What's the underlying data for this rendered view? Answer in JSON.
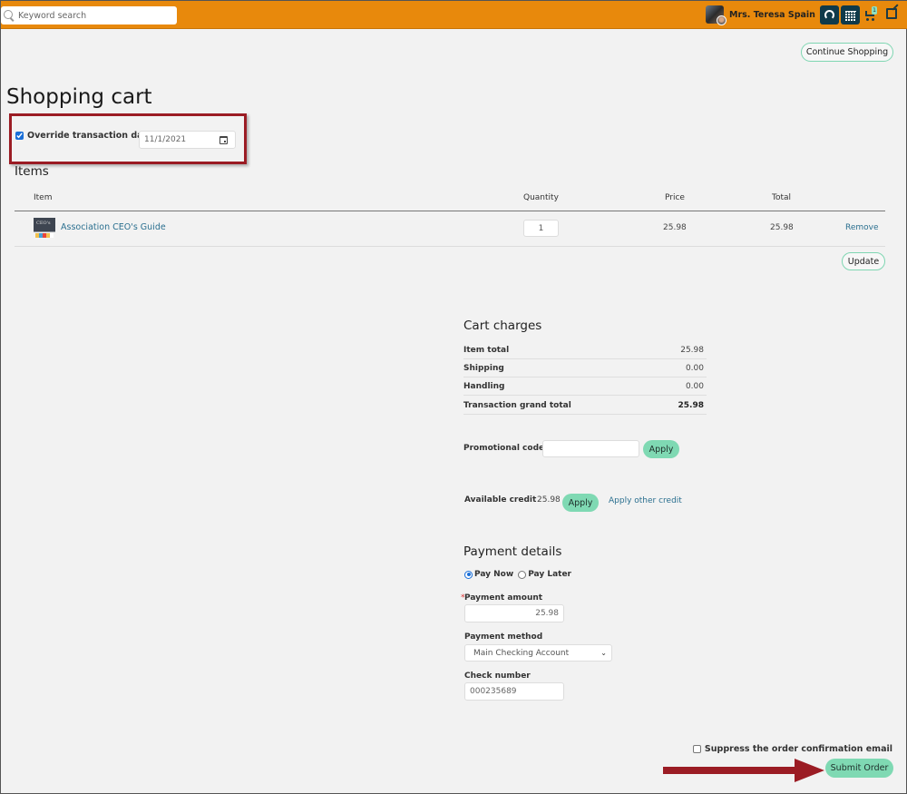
{
  "header": {
    "search_placeholder": "Keyword search",
    "user_name": "Mrs. Teresa Spain",
    "user_menu_chevron": "⌄",
    "cart_count": "1",
    "icons": [
      "search-icon",
      "avatar",
      "chevron-down-icon",
      "headset-icon",
      "calendar-icon",
      "cart-icon",
      "edit-icon"
    ],
    "brand_color": "#e8890c",
    "icon_button_color": "#0f3a4a"
  },
  "continue_shopping_label": "Continue Shopping",
  "page_title": "Shopping cart",
  "override": {
    "label": "Override transaction date",
    "checked": true,
    "date_value": "11/1/2021"
  },
  "items": {
    "title": "Items",
    "columns": [
      "Item",
      "Quantity",
      "Price",
      "Total"
    ],
    "rows": [
      {
        "name": "Association CEO's Guide",
        "thumb_caption": "CEO's",
        "quantity": "1",
        "price": "25.98",
        "total": "25.98",
        "remove_label": "Remove"
      }
    ],
    "update_label": "Update"
  },
  "cart_charges": {
    "title": "Cart charges",
    "rows": [
      {
        "label": "Item total",
        "value": "25.98"
      },
      {
        "label": "Shipping",
        "value": "0.00"
      },
      {
        "label": "Handling",
        "value": "0.00"
      },
      {
        "label": "Transaction grand total",
        "value": "25.98"
      }
    ]
  },
  "promo": {
    "label": "Promotional code",
    "value": "",
    "apply_label": "Apply"
  },
  "credit": {
    "label": "Available credit",
    "amount": "25.98",
    "apply_label": "Apply",
    "other_label": "Apply other credit"
  },
  "payment": {
    "title": "Payment details",
    "options": [
      {
        "label": "Pay Now",
        "selected": true
      },
      {
        "label": "Pay Later",
        "selected": false
      }
    ],
    "amount_required_mark": "*",
    "amount_label": "Payment amount",
    "amount_value": "25.98",
    "method_label": "Payment method",
    "method_value": "Main Checking Account",
    "check_label": "Check number",
    "check_value": "000235689"
  },
  "footer": {
    "suppress_label": "Suppress the order confirmation email",
    "suppress_checked": false,
    "submit_label": "Submit Order"
  },
  "accent_color": "#7fd9b3",
  "annotation_color": "#9b1c24"
}
